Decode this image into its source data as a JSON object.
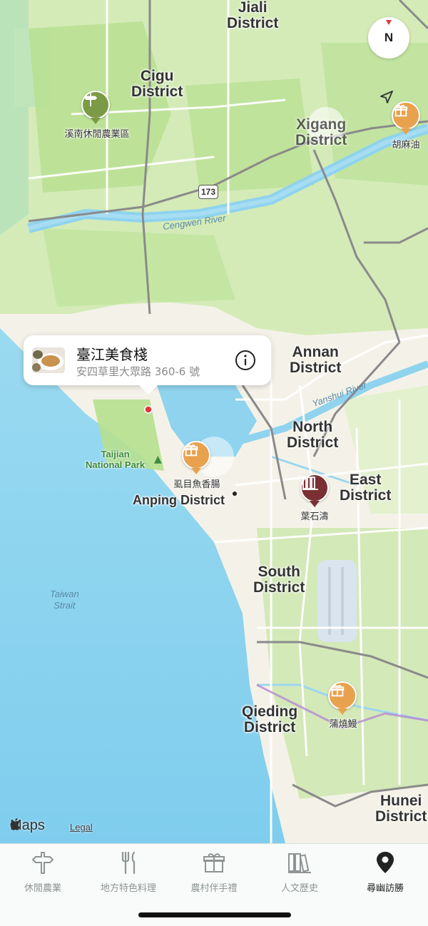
{
  "map": {
    "districts": [
      {
        "id": "jiali",
        "name": "Jiali\nDistrict"
      },
      {
        "id": "cigu",
        "name": "Cigu\nDistrict"
      },
      {
        "id": "xigang",
        "name": "Xigang\nDistrict"
      },
      {
        "id": "annan",
        "name": "Annan\nDistrict"
      },
      {
        "id": "north",
        "name": "North\nDistrict"
      },
      {
        "id": "east",
        "name": "East\nDistrict"
      },
      {
        "id": "south",
        "name": "South\nDistrict"
      },
      {
        "id": "qieding",
        "name": "Qieding\nDistrict"
      },
      {
        "id": "hunei",
        "name": "Hunei\nDistrict"
      },
      {
        "id": "anping",
        "name": "Anping District"
      }
    ],
    "water_labels": [
      {
        "id": "cengwen",
        "text": "Cengwen River"
      },
      {
        "id": "yanshui",
        "text": "Yanshui River"
      },
      {
        "id": "taiwan-strait",
        "text": "Taiwan\nStrait"
      }
    ],
    "park_label": "Taijian\nNational Park",
    "road_shield": "173",
    "pois": [
      {
        "id": "farm-area",
        "label": "溪南休閒農業區",
        "icon": "signpost-icon",
        "color": "#7c9a45"
      },
      {
        "id": "sesame-oil",
        "label": "胡麻油",
        "icon": "gift-icon",
        "color": "#e8a24e"
      },
      {
        "id": "milkfish-sausage",
        "label": "虱目魚香腸",
        "icon": "gift-icon",
        "color": "#e8a24e"
      },
      {
        "id": "ye-shi-tao",
        "label": "葉石濤",
        "icon": "books-icon",
        "color": "#7a2f33"
      },
      {
        "id": "eel",
        "label": "蒲燒鰻",
        "icon": "gift-icon",
        "color": "#e8a24e"
      }
    ],
    "compass_label": "N"
  },
  "callout": {
    "title": "臺江美食棧",
    "address": "安四草里大眾路 360-6 號"
  },
  "attribution": {
    "brand": "Maps",
    "legal": "Legal"
  },
  "tabs": [
    {
      "id": "leisure-farming",
      "label": "休閒農業",
      "icon": "signpost-icon",
      "active": false
    },
    {
      "id": "local-cuisine",
      "label": "地方特色料理",
      "icon": "fork-knife-icon",
      "active": false
    },
    {
      "id": "rural-gifts",
      "label": "農村伴手禮",
      "icon": "gift-icon",
      "active": false
    },
    {
      "id": "culture-history",
      "label": "人文歷史",
      "icon": "books-icon",
      "active": false
    },
    {
      "id": "explore",
      "label": "尋幽訪勝",
      "icon": "map-pin-icon",
      "active": true
    }
  ],
  "colors": {
    "water": "#8fd3ee",
    "land": "#f6f4ec",
    "park": "#c5e6a4",
    "gift_pin": "#e8a24e",
    "farm_pin": "#7c9a45",
    "books_pin": "#7a2f33"
  }
}
